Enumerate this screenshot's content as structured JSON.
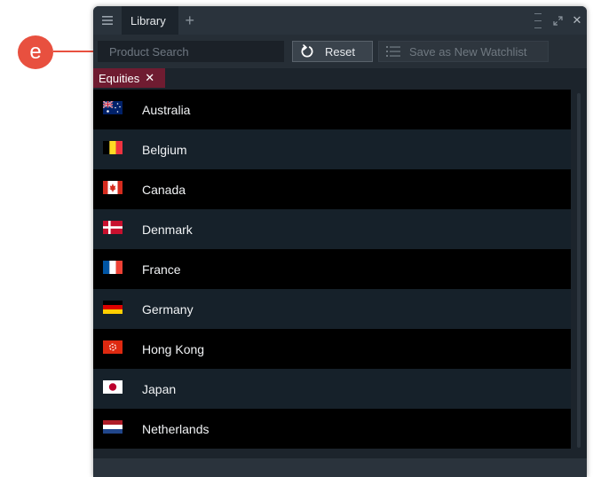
{
  "annotation": {
    "badge_label": "e",
    "color": "#e8503f"
  },
  "window": {
    "tabs": [
      {
        "label": "Library"
      }
    ],
    "add_tab_glyph": "+",
    "close_glyph": "✕"
  },
  "toolbar": {
    "search": {
      "placeholder": "Product Search",
      "value": ""
    },
    "reset_label": "Reset",
    "save_watchlist_label": "Save as New Watchlist"
  },
  "filters": [
    {
      "label": "Equities",
      "remove_glyph": "✕"
    }
  ],
  "countries": [
    {
      "name": "Australia",
      "flag": "australia-flag"
    },
    {
      "name": "Belgium",
      "flag": "belgium-flag"
    },
    {
      "name": "Canada",
      "flag": "canada-flag"
    },
    {
      "name": "Denmark",
      "flag": "denmark-flag"
    },
    {
      "name": "France",
      "flag": "france-flag"
    },
    {
      "name": "Germany",
      "flag": "germany-flag"
    },
    {
      "name": "Hong Kong",
      "flag": "hong-kong-flag"
    },
    {
      "name": "Japan",
      "flag": "japan-flag"
    },
    {
      "name": "Netherlands",
      "flag": "netherlands-flag"
    }
  ],
  "colors": {
    "chip_bg": "#6f1c31",
    "row_dark": "#000000",
    "row_alt": "#16212a",
    "titlebar": "#2a333c"
  }
}
